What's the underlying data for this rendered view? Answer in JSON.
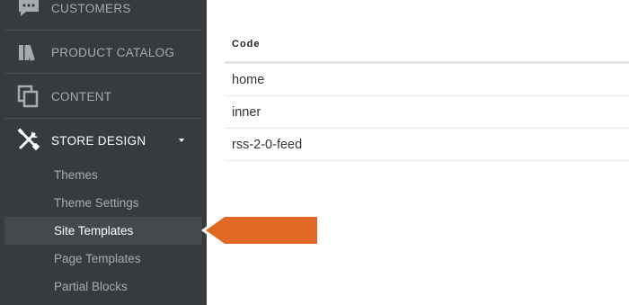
{
  "sidebar": {
    "items": [
      {
        "label": "CUSTOMERS",
        "icon": "chat-bubble-icon"
      },
      {
        "label": "PRODUCT CATALOG",
        "icon": "books-icon"
      },
      {
        "label": "CONTENT",
        "icon": "copy-pages-icon"
      },
      {
        "label": "STORE DESIGN",
        "icon": "tools-icon"
      }
    ],
    "sub_items": [
      {
        "label": "Themes"
      },
      {
        "label": "Theme Settings"
      },
      {
        "label": "Site Templates"
      },
      {
        "label": "Page Templates"
      },
      {
        "label": "Partial Blocks"
      }
    ]
  },
  "table": {
    "header": "Code",
    "rows": [
      "home",
      "inner",
      "rss-2-0-feed"
    ]
  },
  "colors": {
    "sidebar_bg": "#373b3e",
    "active_bg": "#46494c",
    "callout_orange": "#e06a25"
  }
}
